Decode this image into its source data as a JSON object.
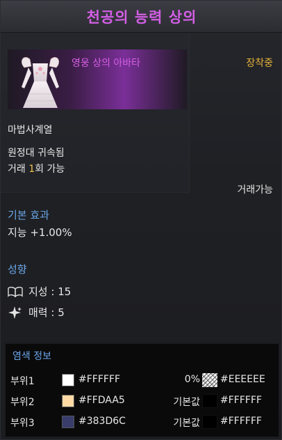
{
  "title": "천공의 능력 상의",
  "item": {
    "name": "영웅 상의 아바타",
    "status": "장착중",
    "class": "마법사계열"
  },
  "bound": "원정대 귀속됨",
  "trade": {
    "prefix": "거래 ",
    "count": "1",
    "suffix": "회 가능"
  },
  "tradable": "거래가능",
  "basic_effect": {
    "title": "기본 효과",
    "value": "지능 +1.00%"
  },
  "tendency": {
    "title": "성향",
    "items": [
      {
        "icon": "book-icon",
        "label": "지성 : 15"
      },
      {
        "icon": "sparkle-icon",
        "label": "매력 : 5"
      }
    ]
  },
  "dye": {
    "title": "염색 정보",
    "rows": [
      {
        "part": "부위1",
        "color": "#FFFFFF",
        "hex": "#FFFFFF",
        "mid": "0%",
        "pattern": "noise",
        "hex2": "#EEEEEE"
      },
      {
        "part": "부위2",
        "color": "#FFDAA5",
        "hex": "#FFDAA5",
        "mid": "기본값",
        "pattern": "solid",
        "hex2": "#FFFFFF"
      },
      {
        "part": "부위3",
        "color": "#383D6C",
        "hex": "#383D6C",
        "mid": "기본값",
        "pattern": "solid",
        "hex2": "#FFFFFF"
      }
    ]
  },
  "colors": {
    "title": "#d45fe6",
    "item_name": "#d55fe4",
    "equipped": "#e7b43a",
    "section": "#6aa6e8",
    "highlight": "#f0c14b"
  }
}
